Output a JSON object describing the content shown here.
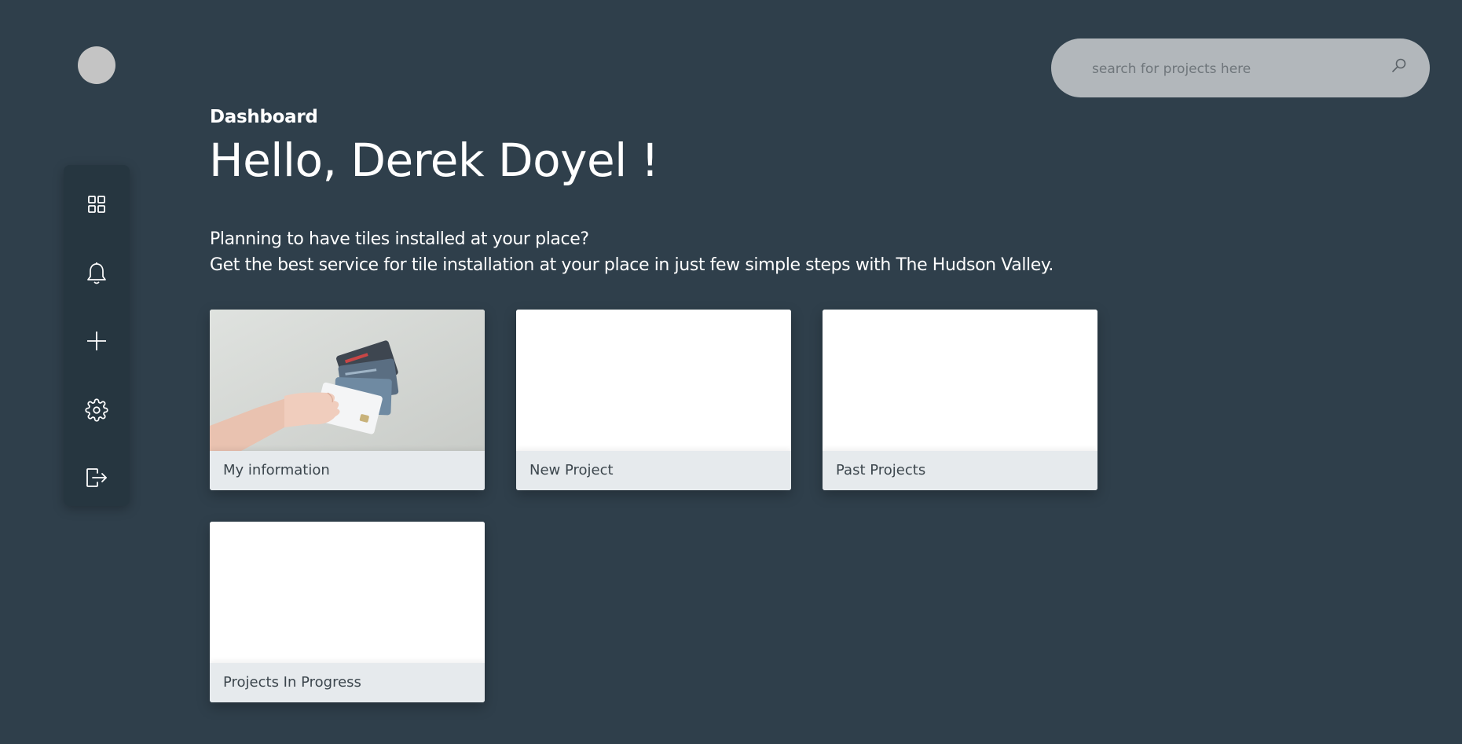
{
  "header": {
    "search_placeholder": "search for projects here"
  },
  "sidebar": {
    "items": [
      {
        "label": "Dashboard",
        "icon": "grid-icon"
      },
      {
        "label": "Notifications",
        "icon": "bell-icon"
      },
      {
        "label": "Add",
        "icon": "plus-icon"
      },
      {
        "label": "Settings",
        "icon": "gear-icon"
      },
      {
        "label": "Logout",
        "icon": "logout-icon"
      }
    ]
  },
  "main": {
    "breadcrumb": "Dashboard",
    "greeting": "Hello, Derek Doyel !",
    "intro_line1": "Planning to have tiles installed at your place?",
    "intro_line2": "Get the best service for tile installation at your place in just few simple steps with The Hudson Valley."
  },
  "cards": [
    {
      "label": "My information",
      "media": "photo-hand-holding-cards"
    },
    {
      "label": "New Project",
      "media": "blank"
    },
    {
      "label": "Past Projects",
      "media": "blank"
    },
    {
      "label": "Projects In Progress",
      "media": "blank"
    }
  ],
  "colors": {
    "background": "#2f3f4b",
    "sidebar": "#263640",
    "search": "#b2b7bb",
    "card_footer": "#e6eaed"
  }
}
